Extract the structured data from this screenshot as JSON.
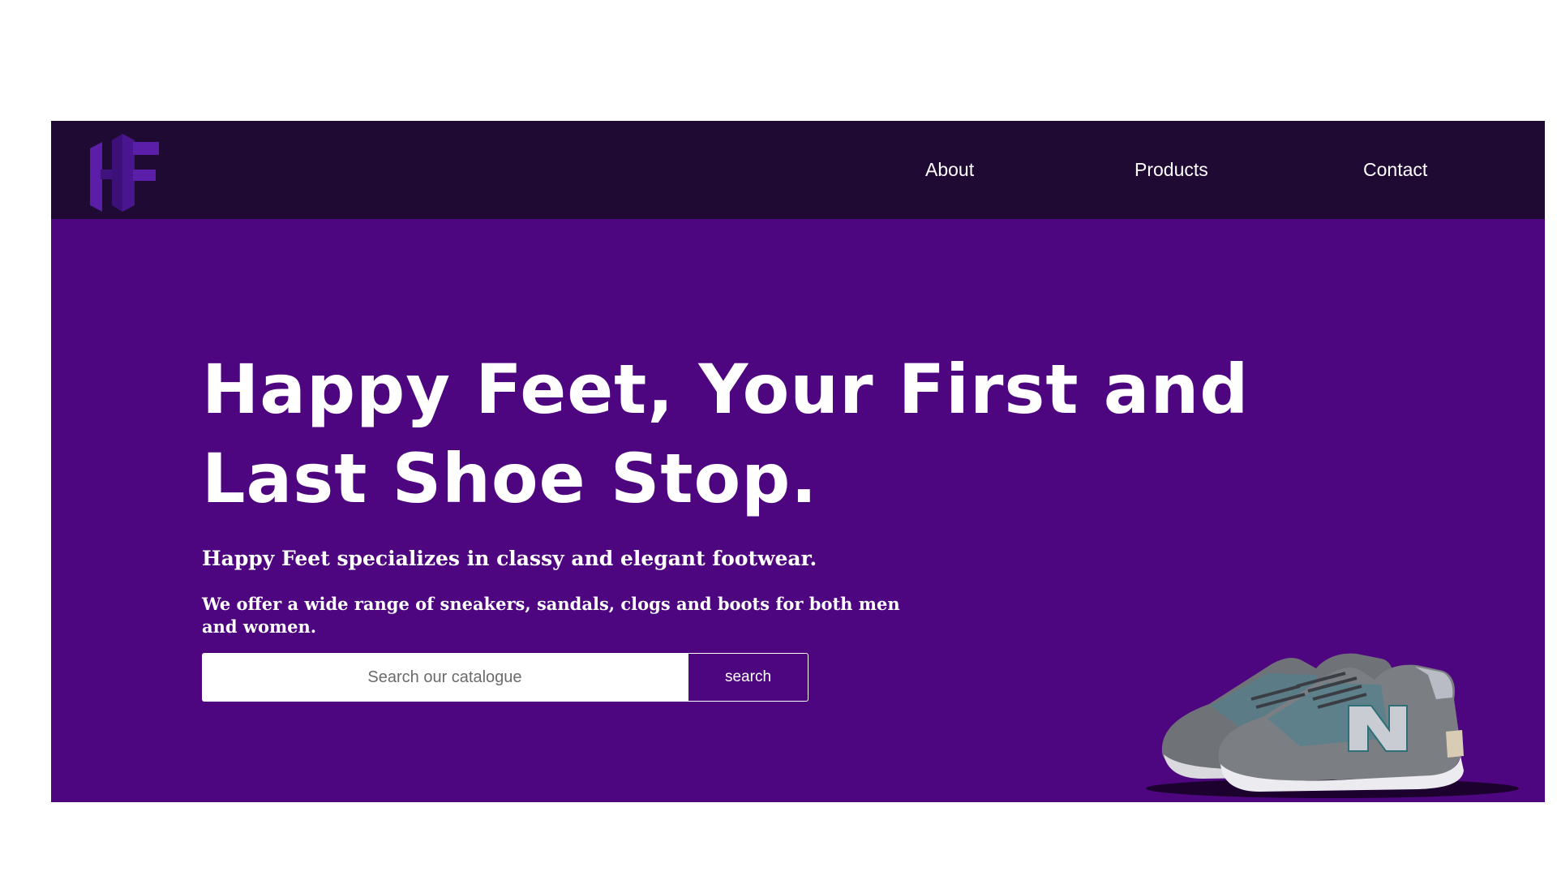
{
  "brand": {
    "logo_icon": "hf-monogram-logo",
    "logo_color": "#4a1690"
  },
  "nav": {
    "items": [
      {
        "label": "About"
      },
      {
        "label": "Products"
      },
      {
        "label": "Contact"
      }
    ]
  },
  "hero": {
    "headline": "Happy Feet, Your First and Last Shoe Stop.",
    "subtitle": "Happy Feet specializes in classy and elegant footwear.",
    "description": "We offer a wide range of sneakers, sandals, clogs and boots for both men and women.",
    "search": {
      "placeholder": "Search our catalogue",
      "value": "",
      "button_label": "search"
    },
    "image": "sneaker-pair-image"
  },
  "colors": {
    "navbar_bg": "#1f0a33",
    "hero_bg": "#4e0680",
    "text": "#ffffff"
  }
}
